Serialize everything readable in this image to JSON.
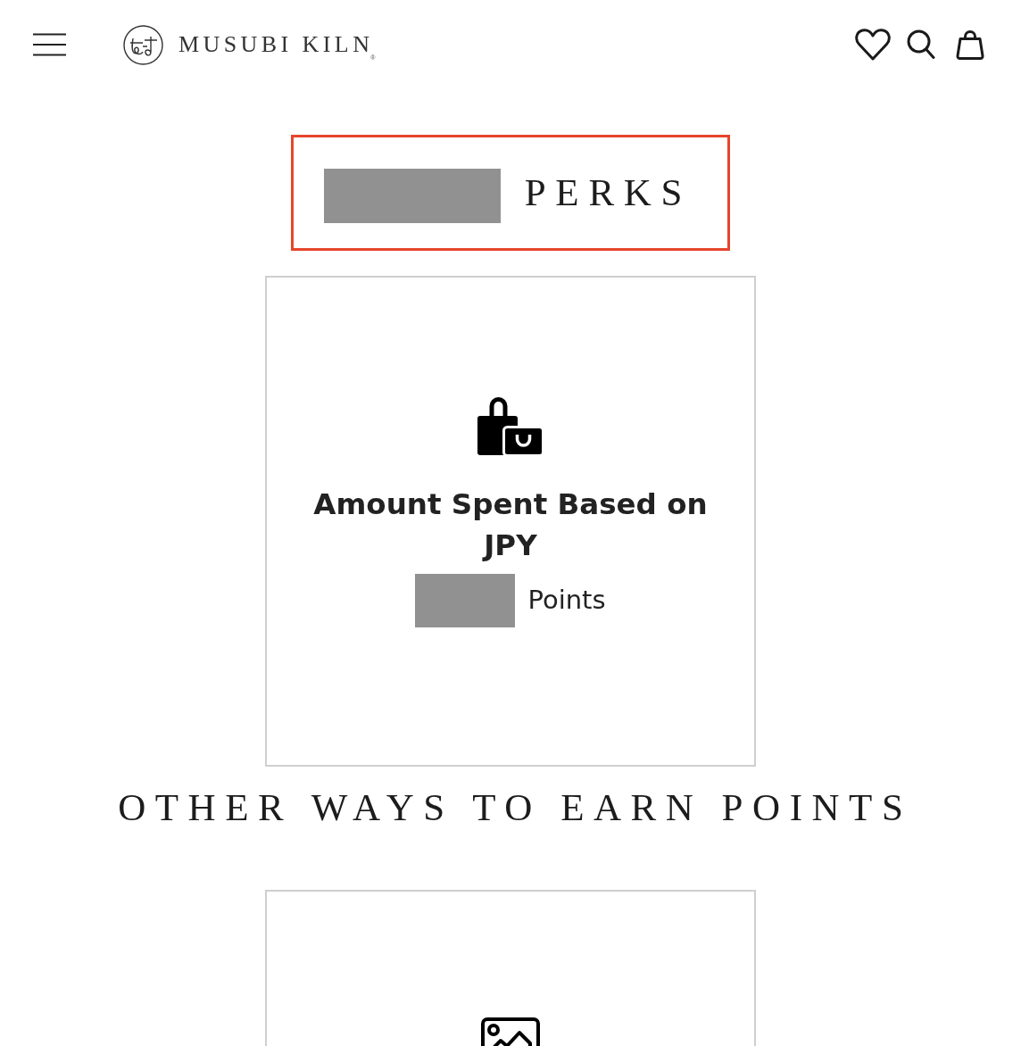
{
  "header": {
    "logo": {
      "name": "MUSUBI KILN",
      "mark": "®"
    }
  },
  "title": {
    "redacted": true,
    "text": "PERKS",
    "highlighted": true
  },
  "perk_cards": [
    {
      "kind": "spend",
      "title": "Amount Spent Based on JPY",
      "points_redacted": true,
      "points_label": "Points"
    }
  ],
  "section_heading": "OTHER WAYS TO EARN POINTS",
  "earn_cards": [
    {
      "kind": "image"
    }
  ]
}
